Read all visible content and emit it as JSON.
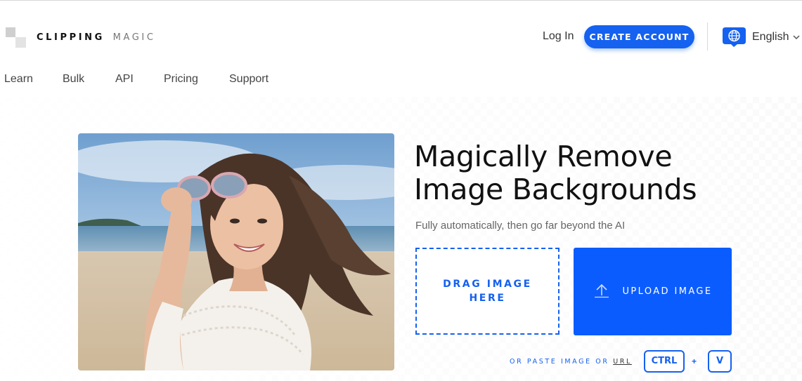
{
  "header": {
    "brand_bold": "CLIPPING",
    "brand_light": "MAGIC",
    "login_label": "Log In",
    "create_account_label": "CREATE ACCOUNT",
    "language_label": "English",
    "accent_color": "#1561f0"
  },
  "nav": {
    "items": [
      {
        "label": "Learn"
      },
      {
        "label": "Bulk"
      },
      {
        "label": "API"
      },
      {
        "label": "Pricing"
      },
      {
        "label": "Support"
      }
    ]
  },
  "hero": {
    "headline_line1": "Magically Remove",
    "headline_line2": "Image Backgrounds",
    "subtitle": "Fully automatically, then go far beyond the AI",
    "drag_line1": "DRAG IMAGE",
    "drag_line2": "HERE",
    "upload_label": "UPLOAD IMAGE",
    "paste_text": "OR PASTE IMAGE OR",
    "paste_url": "URL",
    "key_ctrl": "CTRL",
    "key_plus": "+",
    "key_v": "V",
    "upload_color": "#0b5cff"
  },
  "icons": {
    "logo": "clipping-magic-logo",
    "language": "globe-icon",
    "language_chevron": "chevron-down-icon",
    "upload": "upload-arrow-icon"
  }
}
